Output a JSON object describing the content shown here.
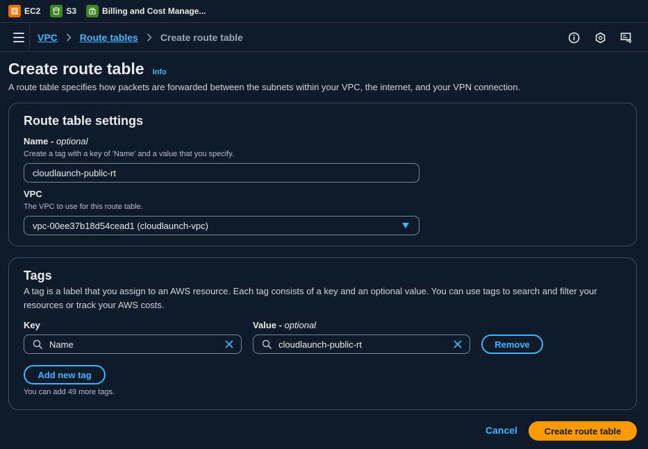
{
  "favorites": [
    {
      "label": "EC2",
      "icon": "ec2-icon",
      "color": "#ed7100"
    },
    {
      "label": "S3",
      "icon": "s3-icon",
      "color": "#3f8624"
    },
    {
      "label": "Billing and Cost Manage...",
      "icon": "billing-icon",
      "color": "#3f8624"
    }
  ],
  "breadcrumb": {
    "vpc": "VPC",
    "route_tables": "Route tables",
    "current": "Create route table"
  },
  "header": {
    "title": "Create route table",
    "info": "Info",
    "description": "A route table specifies how packets are forwarded between the subnets within your VPC, the internet, and your VPN connection."
  },
  "settings": {
    "title": "Route table settings",
    "name_label": "Name",
    "name_optional": "optional",
    "name_desc": "Create a tag with a key of 'Name' and a value that you specify.",
    "name_value": "cloudlaunch-public-rt",
    "vpc_label": "VPC",
    "vpc_desc": "The VPC to use for this route table.",
    "vpc_value": "vpc-00ee37b18d54cead1 (cloudlaunch-vpc)"
  },
  "tags": {
    "title": "Tags",
    "description": "A tag is a label that you assign to an AWS resource. Each tag consists of a key and an optional value. You can use tags to search and filter your resources or track your AWS costs.",
    "key_label": "Key",
    "value_label": "Value",
    "value_optional": "optional",
    "rows": [
      {
        "key": "Name",
        "value": "cloudlaunch-public-rt"
      }
    ],
    "remove_label": "Remove",
    "add_label": "Add new tag",
    "hint": "You can add 49 more tags."
  },
  "footer": {
    "cancel": "Cancel",
    "submit": "Create route table"
  },
  "colors": {
    "background": "#0f1b2a",
    "link": "#42b4ff",
    "primary": "#ff9900",
    "border": "#414d5c"
  }
}
